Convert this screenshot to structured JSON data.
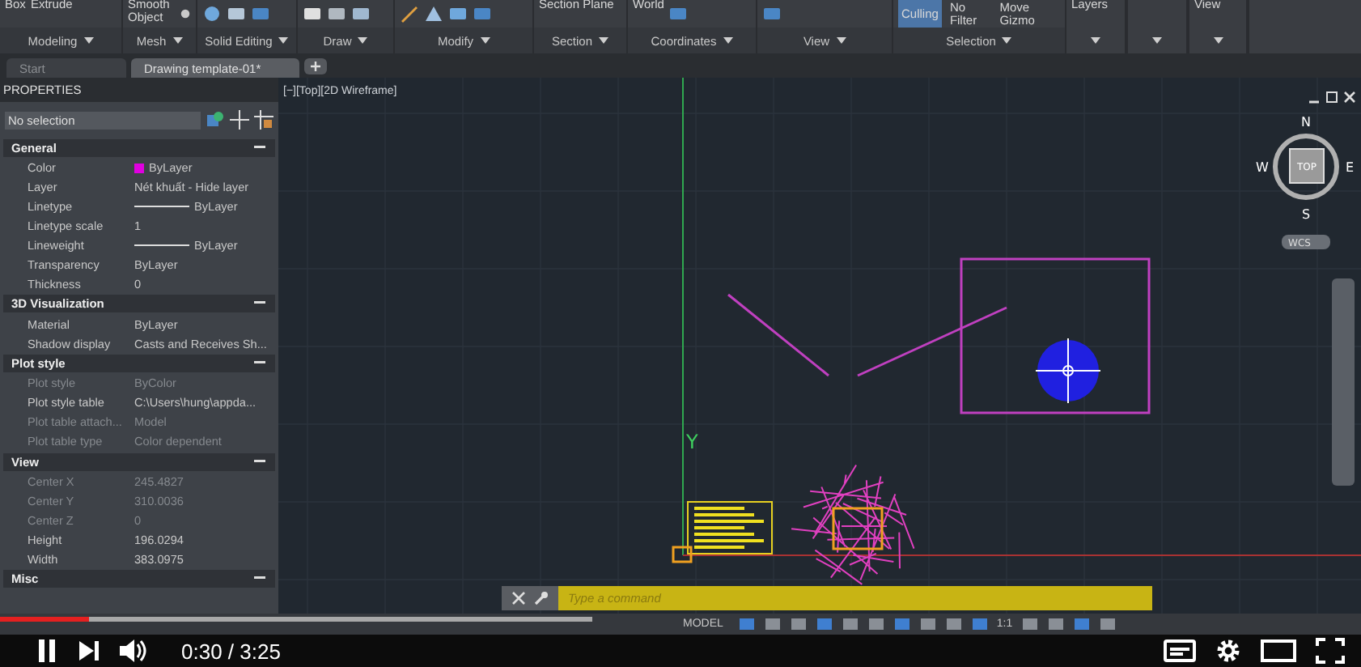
{
  "ribbon": {
    "panels": [
      {
        "label": "Modeling",
        "items": [
          "Box",
          "Extrude"
        ]
      },
      {
        "label": "Mesh",
        "items": [
          "Smooth Object"
        ]
      },
      {
        "label": "Solid Editing"
      },
      {
        "label": "Draw"
      },
      {
        "label": "Modify"
      },
      {
        "label": "Section",
        "items": [
          "Section Plane"
        ]
      },
      {
        "label": "Coordinates",
        "items": [
          "World"
        ]
      },
      {
        "label": "View"
      },
      {
        "label": "Selection",
        "buttons": [
          {
            "label": "Culling",
            "selected": true
          },
          {
            "label": "No Filter",
            "selected": false
          },
          {
            "label": "Move Gizmo",
            "selected": false
          }
        ]
      },
      {
        "items": [
          "Layers"
        ],
        "collapsed": true
      },
      {
        "collapsed": true
      },
      {
        "items": [
          "View"
        ],
        "collapsed": true
      }
    ]
  },
  "tabs": [
    {
      "label": "Start",
      "selected": false
    },
    {
      "label": "Drawing template-01*",
      "selected": true
    }
  ],
  "properties": {
    "title": "PROPERTIES",
    "selector": "No selection",
    "sections": [
      {
        "title": "General",
        "expanded": true,
        "rows": [
          {
            "kind": "swatch",
            "label": "Color",
            "value": "ByLayer",
            "color": "#e000e0",
            "disabled": false
          },
          {
            "kind": "text",
            "label": "Layer",
            "value": "Nét khuất - Hide layer",
            "disabled": false
          },
          {
            "kind": "linetype",
            "label": "Linetype",
            "value": "ByLayer",
            "disabled": false
          },
          {
            "kind": "text",
            "label": "Linetype scale",
            "value": "1",
            "disabled": false
          },
          {
            "kind": "linetype",
            "label": "Lineweight",
            "value": "ByLayer",
            "disabled": false
          },
          {
            "kind": "text",
            "label": "Transparency",
            "value": "ByLayer",
            "disabled": false
          },
          {
            "kind": "text",
            "label": "Thickness",
            "value": "0",
            "disabled": false
          }
        ]
      },
      {
        "title": "3D Visualization",
        "expanded": true,
        "rows": [
          {
            "kind": "text",
            "label": "Material",
            "value": "ByLayer",
            "disabled": false
          },
          {
            "kind": "text",
            "label": "Shadow display",
            "value": "Casts and Receives Sh...",
            "disabled": false
          }
        ]
      },
      {
        "title": "Plot style",
        "expanded": true,
        "rows": [
          {
            "kind": "text",
            "label": "Plot style",
            "value": "ByColor",
            "disabled": true
          },
          {
            "kind": "text",
            "label": "Plot style table",
            "value": "C:\\Users\\hung\\appda...",
            "disabled": false
          },
          {
            "kind": "text",
            "label": "Plot table attach...",
            "value": "Model",
            "disabled": true
          },
          {
            "kind": "text",
            "label": "Plot table type",
            "value": "Color dependent",
            "disabled": true
          }
        ]
      },
      {
        "title": "View",
        "expanded": true,
        "rows": [
          {
            "kind": "text",
            "label": "Center X",
            "value": "245.4827",
            "disabled": true
          },
          {
            "kind": "text",
            "label": "Center Y",
            "value": "310.0036",
            "disabled": true
          },
          {
            "kind": "text",
            "label": "Center Z",
            "value": "0",
            "disabled": true
          },
          {
            "kind": "text",
            "label": "Height",
            "value": "196.0294",
            "disabled": false
          },
          {
            "kind": "text",
            "label": "Width",
            "value": "383.0975",
            "disabled": false
          }
        ]
      },
      {
        "title": "Misc",
        "expanded": true
      }
    ]
  },
  "viewport": {
    "label": "[−][Top][2D Wireframe]",
    "axis_label": "Y",
    "viewcube": {
      "north": "N",
      "south": "S",
      "east": "E",
      "west": "W",
      "face": "TOP",
      "ucs": "WCS"
    }
  },
  "command_line": {
    "placeholder": "Type a command"
  },
  "status_bar": {
    "model": "MODEL",
    "scale": "1:1"
  },
  "video": {
    "time": "0:30 / 3:25",
    "level": 0.15
  }
}
